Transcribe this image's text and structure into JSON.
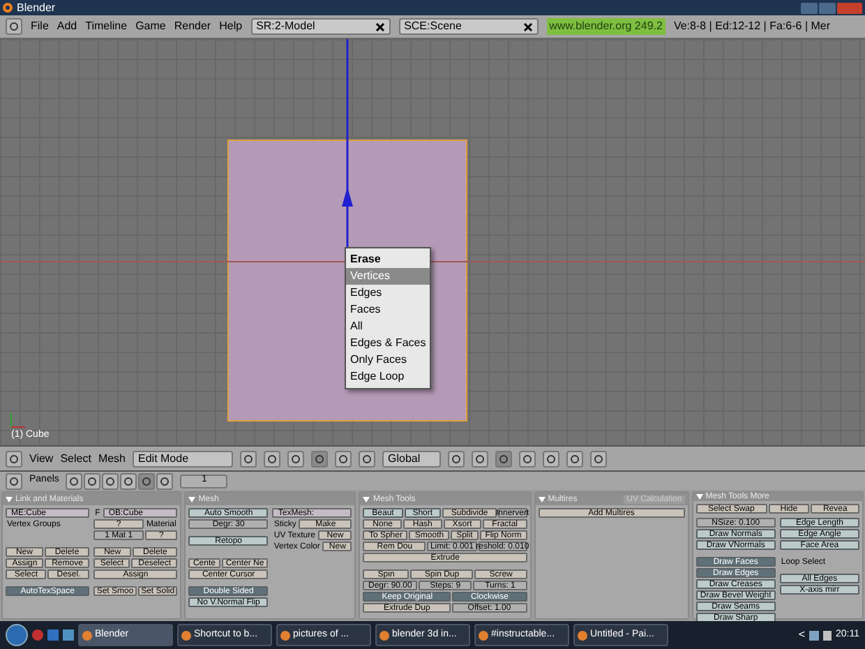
{
  "window": {
    "title": "Blender"
  },
  "menu_bar": {
    "menus": [
      "File",
      "Add",
      "Timeline",
      "Game",
      "Render",
      "Help"
    ],
    "screen": "SR:2-Model",
    "scene": "SCE:Scene",
    "version": "www.blender.org 249.2",
    "stats": "Ve:8-8 | Ed:12-12 | Fa:6-6 | Mer"
  },
  "viewport": {
    "object_label": "(1) Cube",
    "popup": {
      "title": "Erase",
      "items": [
        {
          "label": "Vertices",
          "selected": true
        },
        {
          "label": "Edges",
          "selected": false
        },
        {
          "label": "Faces",
          "selected": false
        },
        {
          "label": "All",
          "selected": false
        },
        {
          "label": "Edges & Faces",
          "selected": false
        },
        {
          "label": "Only Faces",
          "selected": false
        },
        {
          "label": "Edge Loop",
          "selected": false
        }
      ]
    }
  },
  "view_header": {
    "menus": [
      "View",
      "Select",
      "Mesh"
    ],
    "mode": "Edit Mode",
    "orientation": "Global"
  },
  "buttons_header": {
    "label": "Panels",
    "frame": "1"
  },
  "panels": [
    {
      "title": "Link and Materials",
      "columns": [
        {
          "rows": [
            {
              "kind": "row",
              "items": [
                {
                  "kind": "field",
                  "label": "ME:Cube"
                }
              ]
            },
            {
              "kind": "row",
              "items": [
                {
                  "kind": "label",
                  "label": "Vertex Groups"
                }
              ]
            },
            {
              "kind": "gap"
            },
            {
              "kind": "gap"
            },
            {
              "kind": "gap"
            },
            {
              "kind": "row",
              "items": [
                {
                  "kind": "button",
                  "label": "New"
                },
                {
                  "kind": "button",
                  "label": "Delete"
                }
              ]
            },
            {
              "kind": "row",
              "items": [
                {
                  "kind": "button",
                  "label": "Assign"
                },
                {
                  "kind": "button",
                  "label": "Remove"
                }
              ]
            },
            {
              "kind": "row",
              "items": [
                {
                  "kind": "button",
                  "label": "Select"
                },
                {
                  "kind": "button",
                  "label": "Desel."
                }
              ]
            },
            {
              "kind": "gap"
            },
            {
              "kind": "row",
              "items": [
                {
                  "kind": "toggle",
                  "label": "AutoTexSpace",
                  "on": true
                }
              ]
            }
          ]
        },
        {
          "rows": [
            {
              "kind": "row",
              "items": [
                {
                  "kind": "label",
                  "label": "F"
                },
                {
                  "kind": "field",
                  "label": "OB:Cube"
                }
              ]
            },
            {
              "kind": "row",
              "items": [
                {
                  "kind": "button",
                  "label": "?"
                },
                {
                  "kind": "label",
                  "label": "Material"
                }
              ]
            },
            {
              "kind": "row",
              "items": [
                {
                  "kind": "number",
                  "label": "1 Mat 1"
                },
                {
                  "kind": "button",
                  "label": "?"
                }
              ]
            },
            {
              "kind": "gap"
            },
            {
              "kind": "row",
              "items": [
                {
                  "kind": "button",
                  "label": "New"
                },
                {
                  "kind": "button",
                  "label": "Delete"
                }
              ]
            },
            {
              "kind": "row",
              "items": [
                {
                  "kind": "button",
                  "label": "Select"
                },
                {
                  "kind": "button",
                  "label": "Deselect"
                }
              ]
            },
            {
              "kind": "row",
              "items": [
                {
                  "kind": "button",
                  "label": "Assign"
                }
              ]
            },
            {
              "kind": "gap"
            },
            {
              "kind": "row",
              "items": [
                {
                  "kind": "button",
                  "label": "Set Smoo"
                },
                {
                  "kind": "button",
                  "label": "Set Solid"
                }
              ]
            }
          ]
        }
      ]
    },
    {
      "title": "Mesh",
      "columns": [
        {
          "rows": [
            {
              "kind": "row",
              "items": [
                {
                  "kind": "toggle",
                  "label": "Auto Smooth",
                  "on": false
                }
              ]
            },
            {
              "kind": "row",
              "items": [
                {
                  "kind": "number",
                  "label": "Degr: 30"
                }
              ]
            },
            {
              "kind": "gap"
            },
            {
              "kind": "row",
              "items": [
                {
                  "kind": "toggle",
                  "label": "Retopo",
                  "on": false
                }
              ]
            },
            {
              "kind": "gap"
            },
            {
              "kind": "gap"
            },
            {
              "kind": "row",
              "items": [
                {
                  "kind": "button",
                  "label": "Cente"
                },
                {
                  "kind": "button",
                  "label": "Center Ne"
                }
              ]
            },
            {
              "kind": "row",
              "items": [
                {
                  "kind": "button",
                  "label": "Center Cursor"
                }
              ]
            },
            {
              "kind": "gap"
            },
            {
              "kind": "row",
              "items": [
                {
                  "kind": "toggle",
                  "label": "Double Sided",
                  "on": true
                }
              ]
            },
            {
              "kind": "row",
              "items": [
                {
                  "kind": "toggle",
                  "label": "No V.Normal Flip",
                  "on": false
                }
              ]
            }
          ]
        },
        {
          "rows": [
            {
              "kind": "row",
              "items": [
                {
                  "kind": "field",
                  "label": "TexMesh:"
                }
              ]
            },
            {
              "kind": "row",
              "items": [
                {
                  "kind": "label",
                  "label": "Sticky"
                },
                {
                  "kind": "button",
                  "label": "Make"
                }
              ]
            },
            {
              "kind": "row",
              "items": [
                {
                  "kind": "label",
                  "label": "UV Texture"
                },
                {
                  "kind": "button",
                  "label": "New"
                }
              ]
            },
            {
              "kind": "row",
              "items": [
                {
                  "kind": "label",
                  "label": "Vertex Color"
                },
                {
                  "kind": "button",
                  "label": "New"
                }
              ]
            }
          ]
        }
      ]
    },
    {
      "title": "Mesh Tools",
      "columns": [
        {
          "rows": [
            {
              "kind": "row",
              "items": [
                {
                  "kind": "toggle",
                  "label": "Beaut",
                  "on": false
                },
                {
                  "kind": "toggle",
                  "label": "Short",
                  "on": false
                },
                {
                  "kind": "button",
                  "label": "Subdivide"
                },
                {
                  "kind": "number",
                  "label": "Innervert"
                }
              ]
            },
            {
              "kind": "row",
              "items": [
                {
                  "kind": "button",
                  "label": "None"
                },
                {
                  "kind": "button",
                  "label": "Hash"
                },
                {
                  "kind": "button",
                  "label": "Xsort"
                },
                {
                  "kind": "button",
                  "label": "Fractal"
                }
              ]
            },
            {
              "kind": "row",
              "items": [
                {
                  "kind": "button",
                  "label": "To Spher"
                },
                {
                  "kind": "button",
                  "label": "Smooth"
                },
                {
                  "kind": "button",
                  "label": "Split"
                },
                {
                  "kind": "button",
                  "label": "Flip Norm"
                }
              ]
            },
            {
              "kind": "row",
              "items": [
                {
                  "kind": "button",
                  "label": "Rem Dou"
                },
                {
                  "kind": "number",
                  "label": "Limit: 0.001"
                },
                {
                  "kind": "number",
                  "label": "reshold: 0.010"
                }
              ]
            },
            {
              "kind": "row",
              "items": [
                {
                  "kind": "button",
                  "label": "Extrude"
                }
              ]
            },
            {
              "kind": "gap"
            },
            {
              "kind": "row",
              "items": [
                {
                  "kind": "button",
                  "label": "Spin"
                },
                {
                  "kind": "button",
                  "label": "Spin Dup"
                },
                {
                  "kind": "button",
                  "label": "Screw"
                }
              ]
            },
            {
              "kind": "row",
              "items": [
                {
                  "kind": "number",
                  "label": "Degr: 90.00"
                },
                {
                  "kind": "number",
                  "label": "Steps: 9"
                },
                {
                  "kind": "number",
                  "label": "Turns: 1"
                }
              ]
            },
            {
              "kind": "row",
              "items": [
                {
                  "kind": "toggle",
                  "label": "Keep Original",
                  "on": true
                },
                {
                  "kind": "toggle",
                  "label": "Clockwise",
                  "on": true
                }
              ]
            },
            {
              "kind": "row",
              "items": [
                {
                  "kind": "button",
                  "label": "Extrude Dup"
                },
                {
                  "kind": "number",
                  "label": "Offset: 1.00"
                }
              ]
            }
          ]
        }
      ]
    },
    {
      "title": "Multires",
      "tab": "UV Calculation",
      "columns": [
        {
          "rows": [
            {
              "kind": "row",
              "items": [
                {
                  "kind": "button",
                  "label": "Add Multires"
                }
              ]
            }
          ]
        }
      ]
    },
    {
      "title": "Mesh Tools More",
      "columns": [
        {
          "rows": [
            {
              "kind": "row",
              "items": [
                {
                  "kind": "button",
                  "label": "Select Swap"
                },
                {
                  "kind": "button",
                  "label": "Hide"
                },
                {
                  "kind": "button",
                  "label": "Revea"
                }
              ]
            }
          ]
        },
        {
          "rows": [
            {
              "kind": "row",
              "items": [
                {
                  "kind": "number",
                  "label": "NSize: 0.100"
                }
              ]
            },
            {
              "kind": "row",
              "items": [
                {
                  "kind": "toggle",
                  "label": "Draw Normals",
                  "on": false
                }
              ]
            },
            {
              "kind": "row",
              "items": [
                {
                  "kind": "toggle",
                  "label": "Draw VNormals",
                  "on": false
                }
              ]
            },
            {
              "kind": "gap"
            },
            {
              "kind": "row",
              "items": [
                {
                  "kind": "toggle",
                  "label": "Draw Faces",
                  "on": true
                }
              ]
            },
            {
              "kind": "row",
              "items": [
                {
                  "kind": "toggle",
                  "label": "Draw Edges",
                  "on": true
                }
              ]
            },
            {
              "kind": "row",
              "items": [
                {
                  "kind": "toggle",
                  "label": "Draw Creases",
                  "on": false
                }
              ]
            },
            {
              "kind": "row",
              "items": [
                {
                  "kind": "toggle",
                  "label": "Draw Bevel Weight",
                  "on": false
                }
              ]
            },
            {
              "kind": "row",
              "items": [
                {
                  "kind": "toggle",
                  "label": "Draw Seams",
                  "on": false
                }
              ]
            },
            {
              "kind": "row",
              "items": [
                {
                  "kind": "toggle",
                  "label": "Draw Sharp",
                  "on": false
                }
              ]
            }
          ]
        },
        {
          "rows": [
            {
              "kind": "row",
              "items": [
                {
                  "kind": "toggle",
                  "label": "Edge Length",
                  "on": false
                }
              ]
            },
            {
              "kind": "row",
              "items": [
                {
                  "kind": "toggle",
                  "label": "Edge Angle",
                  "on": false
                }
              ]
            },
            {
              "kind": "row",
              "items": [
                {
                  "kind": "toggle",
                  "label": "Face Area",
                  "on": false
                }
              ]
            },
            {
              "kind": "gap"
            },
            {
              "kind": "row",
              "items": [
                {
                  "kind": "label",
                  "label": "Loop Select"
                }
              ]
            },
            {
              "kind": "gap"
            },
            {
              "kind": "row",
              "items": [
                {
                  "kind": "toggle",
                  "label": "All Edges",
                  "on": false
                }
              ]
            },
            {
              "kind": "row",
              "items": [
                {
                  "kind": "toggle",
                  "label": "X-axis mirr",
                  "on": false
                }
              ]
            }
          ]
        }
      ]
    }
  ],
  "taskbar": {
    "tasks": [
      {
        "label": "Blender",
        "selected": true
      },
      {
        "label": "Shortcut to b...",
        "selected": false
      },
      {
        "label": "pictures of ...",
        "selected": false
      },
      {
        "label": "blender 3d in...",
        "selected": false
      },
      {
        "label": "#instructable...",
        "selected": false
      },
      {
        "label": "Untitled - Pai...",
        "selected": false
      }
    ],
    "tray_arrow": "<",
    "time": "20:11"
  }
}
